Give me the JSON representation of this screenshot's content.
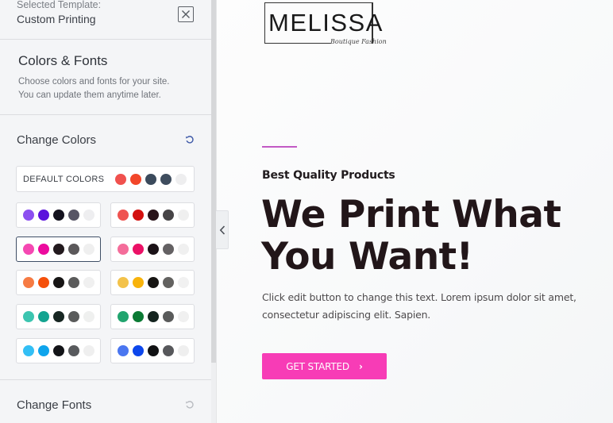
{
  "sidebar": {
    "template_label": "Selected Template:",
    "template_name": "Custom Printing",
    "colors_fonts": {
      "title": "Colors & Fonts",
      "description_line1": "Choose colors and fonts for your site.",
      "description_line2": "You can update them anytime later."
    },
    "change_colors": {
      "title": "Change Colors",
      "default_palette": {
        "label": "DEFAULT COLORS",
        "colors": [
          "#f0514e",
          "#f2462a",
          "#3b4a5c",
          "#3f4d5e",
          "#eeeeef"
        ]
      },
      "palettes": [
        {
          "colors": [
            "#8c4ff0",
            "#5b11dc",
            "#14121e",
            "#575565",
            "#eeeef0"
          ],
          "selected": false
        },
        {
          "colors": [
            "#ef5350",
            "#d3110f",
            "#2a141a",
            "#464446",
            "#efefef"
          ],
          "selected": false
        },
        {
          "colors": [
            "#f548b2",
            "#ec0b9e",
            "#231a1e",
            "#5b585a",
            "#efefef"
          ],
          "selected": true
        },
        {
          "colors": [
            "#f46d9a",
            "#eb1166",
            "#1b1217",
            "#646163",
            "#f0f0f0"
          ],
          "selected": false
        },
        {
          "colors": [
            "#f67b43",
            "#f5500b",
            "#171515",
            "#5b5b5b",
            "#f0f0f0"
          ],
          "selected": false
        },
        {
          "colors": [
            "#f3c24a",
            "#f8b30b",
            "#171513",
            "#636260",
            "#f1f1f1"
          ],
          "selected": false
        },
        {
          "colors": [
            "#3cc5b0",
            "#13a390",
            "#172622",
            "#5a5b5b",
            "#eff0ef"
          ],
          "selected": false
        },
        {
          "colors": [
            "#21a46e",
            "#0b7a34",
            "#14241f",
            "#5a5b5b",
            "#f0f0f0"
          ],
          "selected": false
        },
        {
          "colors": [
            "#33bff5",
            "#0ea4ec",
            "#131418",
            "#585a5d",
            "#efefef"
          ],
          "selected": false
        },
        {
          "colors": [
            "#4a76f0",
            "#0d47ec",
            "#111214",
            "#57585b",
            "#efefef"
          ],
          "selected": false
        }
      ]
    },
    "change_fonts": {
      "title": "Change Fonts"
    }
  },
  "icons": {
    "close": "close-icon",
    "reset": "reset-icon",
    "collapse": "chevron-left-icon",
    "cta_arrow": "›"
  },
  "preview": {
    "logo": {
      "name": "MELISSA",
      "tagline": "Boutique Fashion"
    },
    "accent_color": "#c259c4",
    "eyebrow": "Best Quality Products",
    "headline_line1": "We Print What",
    "headline_line2": "You Want!",
    "body_line1": "Click edit button to change this text. Lorem ipsum dolor sit amet,",
    "body_line2": "consectetur adipiscing elit. Sapien.",
    "cta": {
      "label": "GET STARTED",
      "color": "#f73cb6"
    }
  }
}
